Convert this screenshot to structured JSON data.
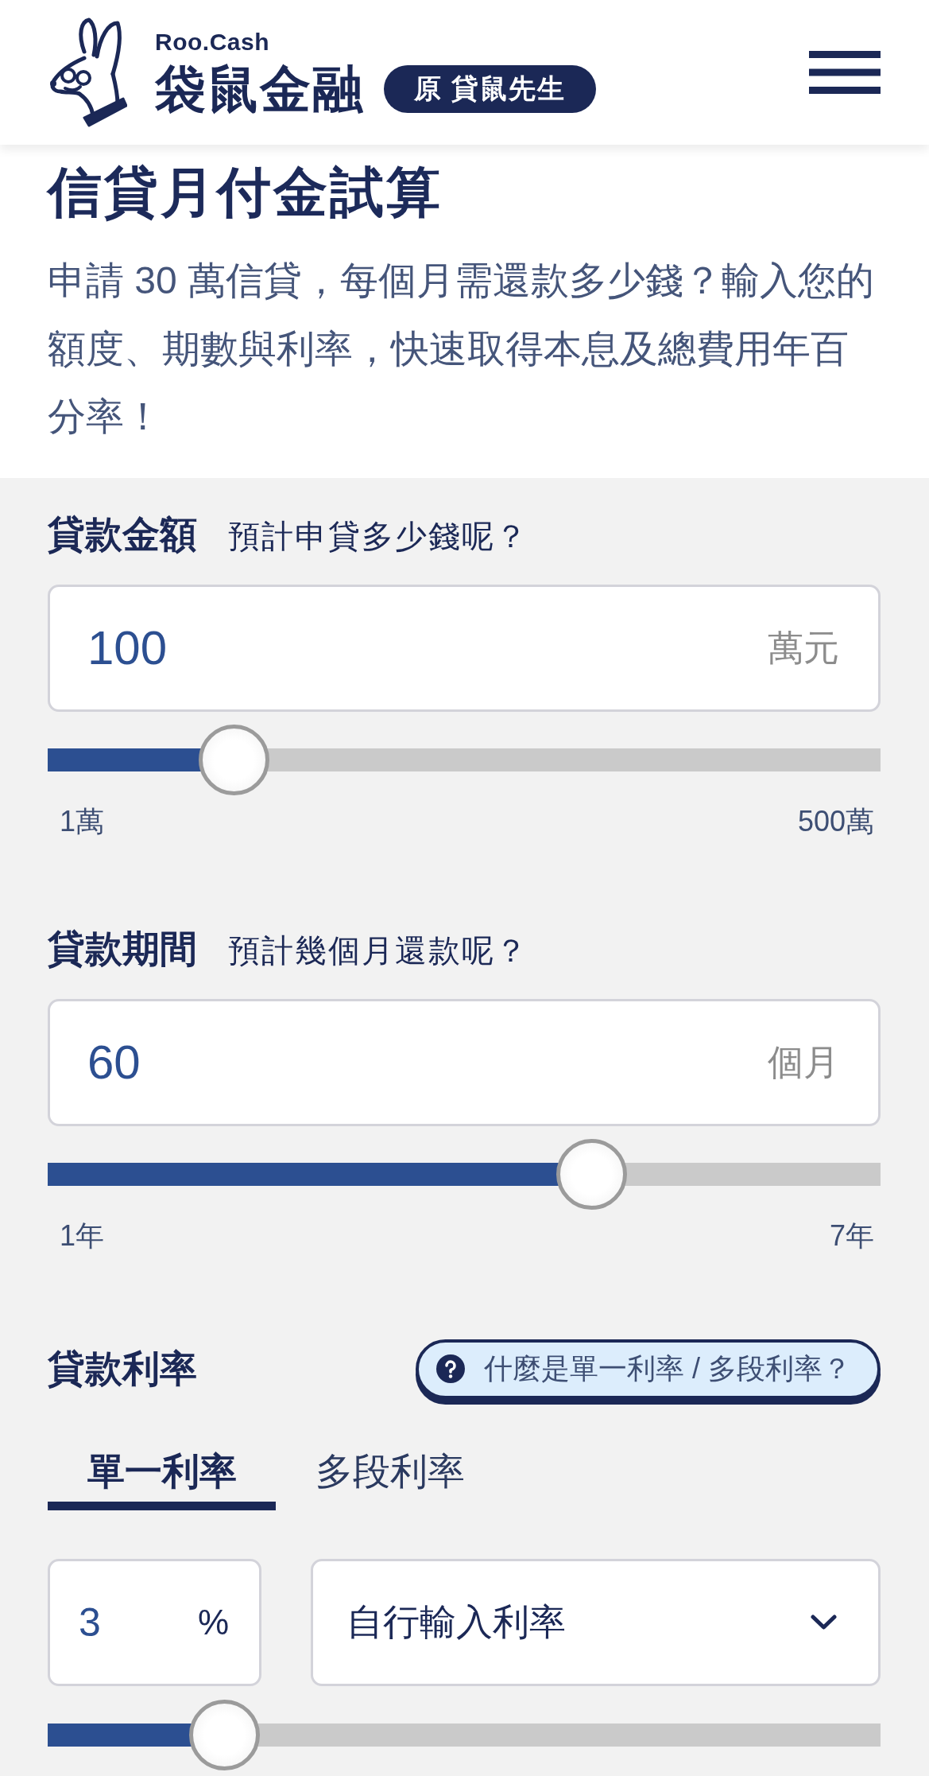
{
  "header": {
    "logo_caption": "Roo.Cash",
    "logo_name": "袋鼠金融",
    "badge": "原 貸鼠先生"
  },
  "intro": {
    "title": "信貸月付金試算",
    "description": "申請 30 萬信貸，每個月需還款多少錢？輸入您的額度、期數與利率，快速取得本息及總費用年百分率！"
  },
  "loan_fields": [
    {
      "label": "貸款金額",
      "hint": "預計申貸多少錢呢？",
      "value": "100",
      "unit": "萬元",
      "level": 0.198,
      "min_label": "1萬",
      "max_label": "500萬"
    },
    {
      "label": "貸款期間",
      "hint": "預計幾個月還款呢？",
      "value": "60",
      "unit": "個月",
      "level": 0.667,
      "min_label": "1年",
      "max_label": "7年"
    }
  ],
  "rate": {
    "label": "貸款利率",
    "help_button": "什麼是單一利率 / 多段利率？",
    "tabs": [
      {
        "label": "單一利率",
        "selected": true
      },
      {
        "label": "多段利率",
        "selected": false
      }
    ],
    "value": "3",
    "unit": "%",
    "preset": "自行輸入利率",
    "level": 0.186
  }
}
